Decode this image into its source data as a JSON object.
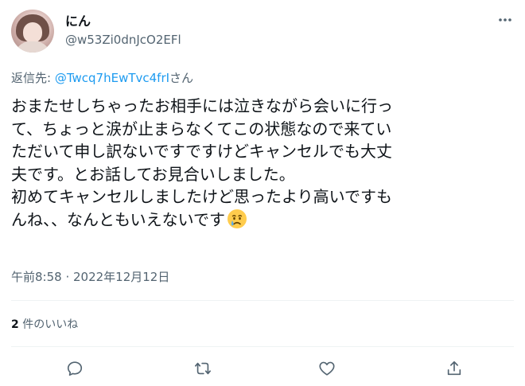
{
  "user": {
    "name": "にん",
    "handle": "@w53Zi0dnJcO2EFl"
  },
  "reply": {
    "prefix": "返信先: ",
    "mention": "@Twcq7hEwTvc4frI",
    "suffix": "さん"
  },
  "tweet": {
    "text": "おまたせしちゃったお相手には泣きながら会いに行っ\nて、ちょっと涙が止まらなくてこの状態なので来てい\nただいて申し訳ないですですけどキャンセルでも大丈\n夫です。とお話してお見合いしました。\n初めてキャンセルしましたけど思ったより高いですも\nんね、、なんともいえないです"
  },
  "emoji": "crying-face",
  "timestamp": "午前8:58 · 2022年12月12日",
  "likes": {
    "count": "2",
    "label": " 件のいいね"
  },
  "icons": [
    "more-icon",
    "reply-icon",
    "retweet-icon",
    "like-icon",
    "share-icon"
  ],
  "colors": {
    "text": "#0f1419",
    "secondary": "#536471",
    "link": "#1d9bf0",
    "divider": "#eff3f4"
  }
}
